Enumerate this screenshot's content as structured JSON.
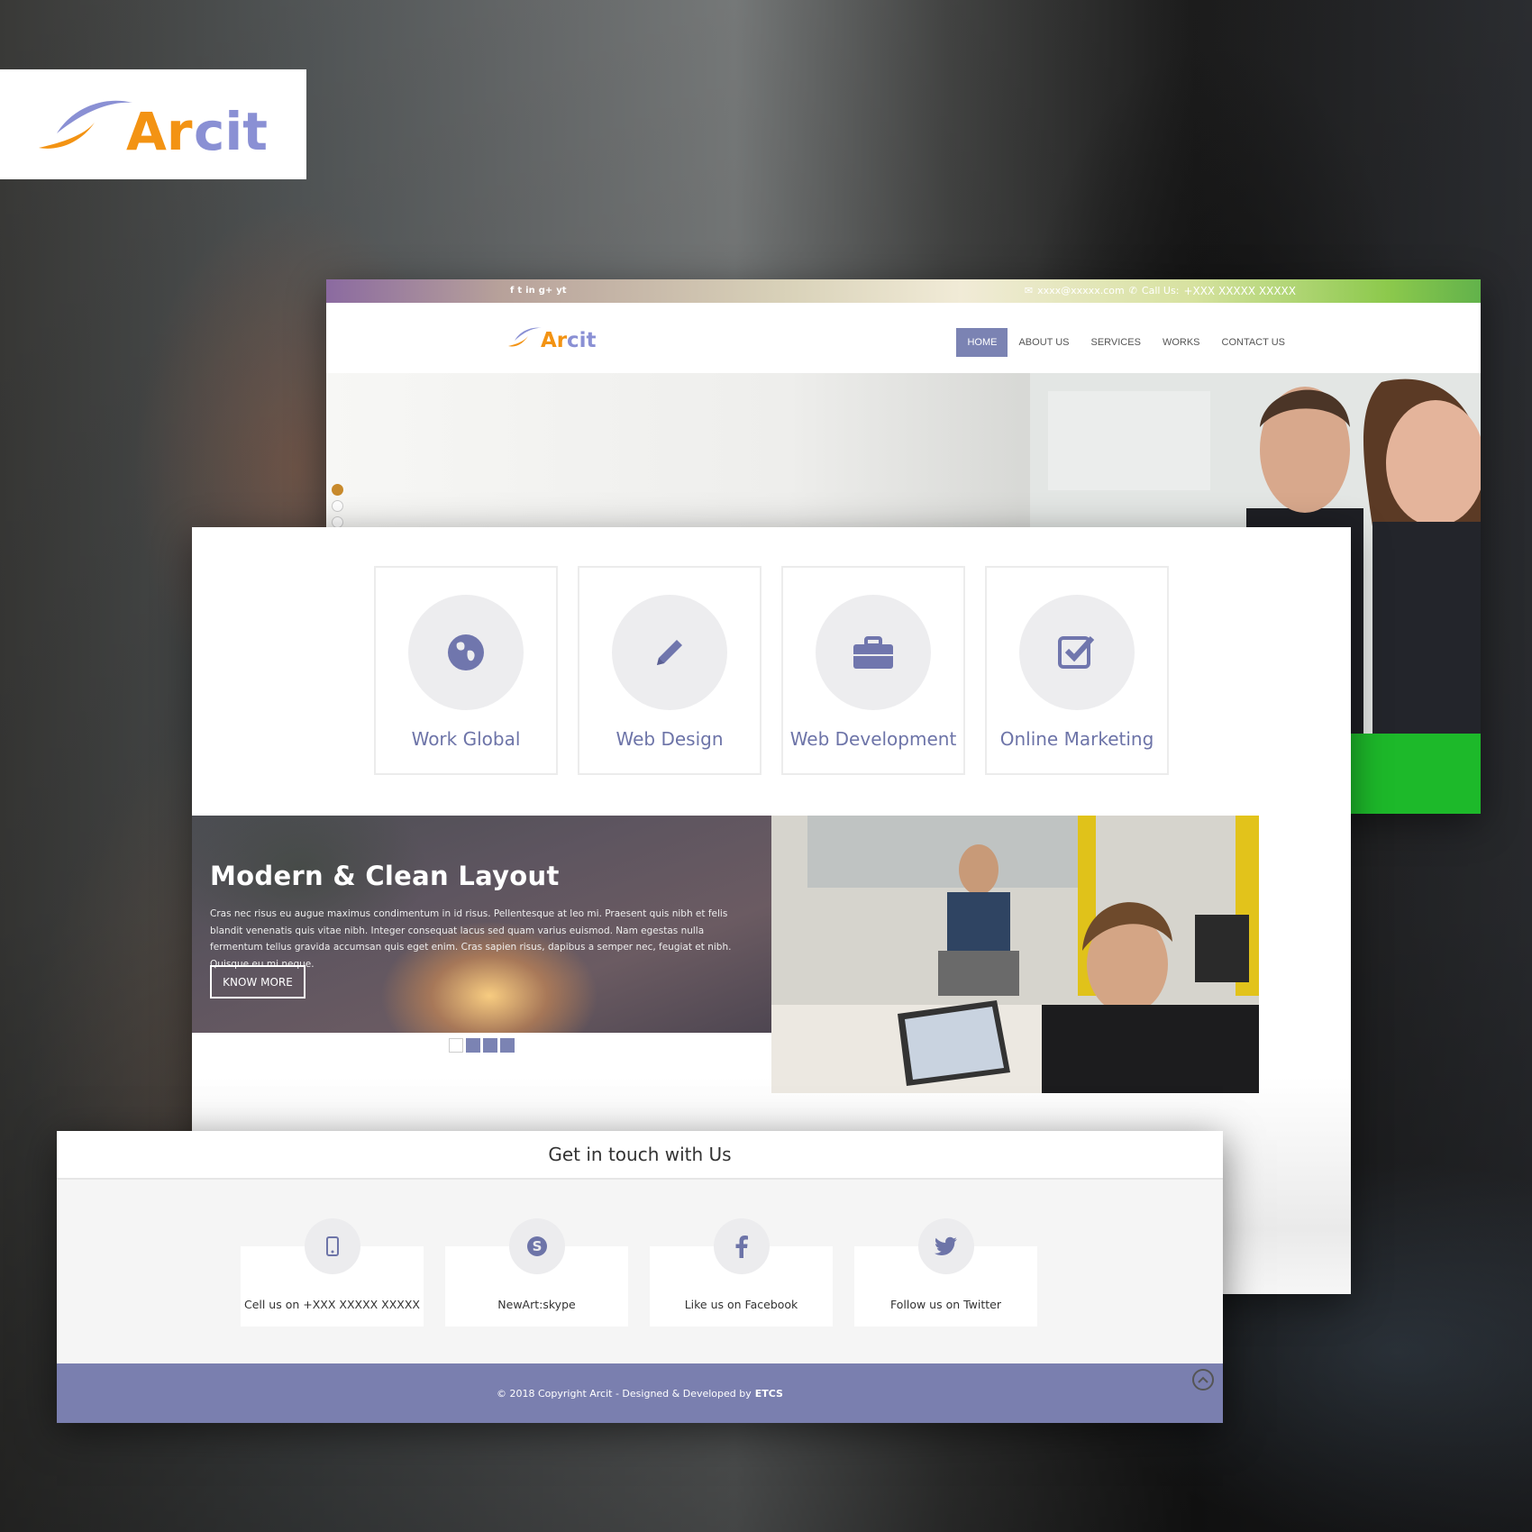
{
  "brand": {
    "logo_part_a": "Ar",
    "logo_part_b": "cit",
    "accent_orange": "#f39313",
    "accent_purple": "#7b83b3"
  },
  "topbar": {
    "socials": [
      "f",
      "t",
      "in",
      "g+",
      "yt"
    ],
    "email": "xxxx@xxxxx.com",
    "call_label": "Call Us:",
    "phone": "+XXX XXXXX XXXXX"
  },
  "nav": {
    "items": [
      "HOME",
      "ABOUT US",
      "SERVICES",
      "WORKS",
      "CONTACT US"
    ]
  },
  "services": [
    {
      "label": "Work Global",
      "icon": "globe-icon"
    },
    {
      "label": "Web Design",
      "icon": "pencil-icon"
    },
    {
      "label": "Web Development",
      "icon": "briefcase-icon"
    },
    {
      "label": "Online Marketing",
      "icon": "checkbox-icon"
    }
  ],
  "feature": {
    "title": "Modern & Clean Layout",
    "text": "Cras nec risus eu augue maximus condimentum in id risus. Pellentesque at leo mi. Praesent quis nibh et felis blandit venenatis quis vitae nibh. Integer consequat lacus sed quam varius euismod. Nam egestas nulla fermentum tellus gravida accumsan quis eget enim. Cras sapien risus, dapibus a semper nec, feugiat et nibh. Quisque eu mi neque.",
    "button": "KNOW MORE"
  },
  "contact": {
    "heading": "Get in touch with Us",
    "cards": [
      {
        "label": "Cell us on +XXX XXXXX XXXXX",
        "icon": "mobile-icon"
      },
      {
        "label": "NewArt:skype",
        "icon": "skype-icon"
      },
      {
        "label": "Like us on Facebook",
        "icon": "facebook-icon"
      },
      {
        "label": "Follow us on Twitter",
        "icon": "twitter-icon"
      }
    ]
  },
  "footer": {
    "copyright": "© 2018 Copyright Arcit - Designed & Developed by",
    "developer": "ETCS"
  }
}
